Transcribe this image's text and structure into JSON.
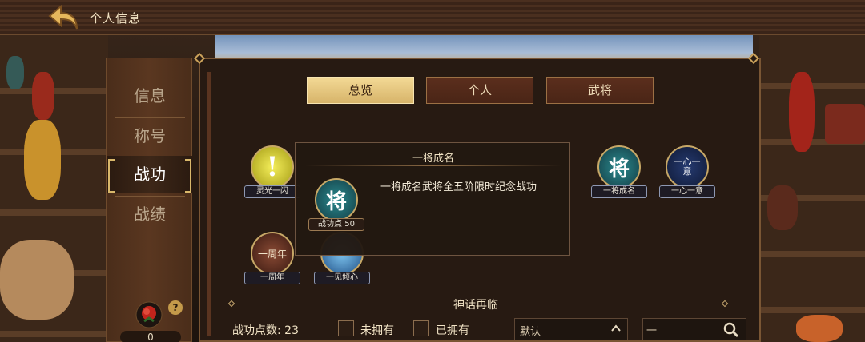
{
  "header": {
    "title": "个人信息"
  },
  "sidebar": {
    "items": [
      {
        "label": "信息",
        "active": false
      },
      {
        "label": "称号",
        "active": false
      },
      {
        "label": "战功",
        "active": true
      },
      {
        "label": "战绩",
        "active": false
      }
    ],
    "rose_count": "0",
    "help_label": "?"
  },
  "tabs": [
    {
      "label": "总览",
      "active": true
    },
    {
      "label": "个人",
      "active": false
    },
    {
      "label": "武将",
      "active": false
    }
  ],
  "badges": [
    {
      "name": "灵光一闪",
      "glyph": "!",
      "color": "#d9d12a"
    },
    {
      "name": "一将成名",
      "glyph": "将",
      "color": "#1f6e73"
    },
    {
      "name": "一心一意",
      "glyph": "一心一意",
      "color": "#1b2a55"
    },
    {
      "name": "一周年",
      "glyph": "一周年",
      "color": "#6a3a2a"
    },
    {
      "name": "一见倾心",
      "glyph": "",
      "color": "#3b7fb8"
    }
  ],
  "tooltip": {
    "title": "一将成名",
    "description": "一将成名武将全五阶限时纪念战功",
    "badge_glyph": "将",
    "badge_label": "战功点 50"
  },
  "section": {
    "title": "神话再临"
  },
  "footer": {
    "points_label": "战功点数: 23",
    "filter_not_owned": "未拥有",
    "filter_owned": "已拥有",
    "sort_value": "默认",
    "search_placeholder": "一"
  }
}
